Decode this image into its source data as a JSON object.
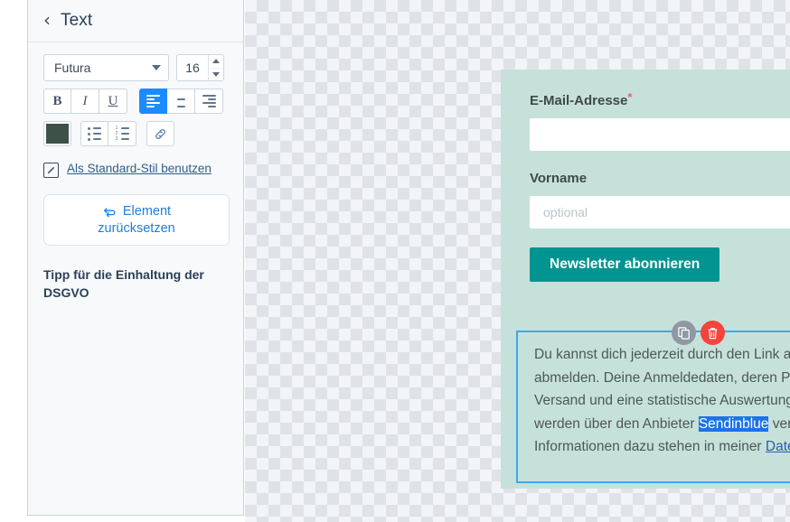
{
  "sidebar": {
    "back_icon": "chevron-left-icon",
    "title": "Text",
    "font": {
      "value": "Futura",
      "dropdown_icon": "chevron-down-icon"
    },
    "font_size": {
      "value": "16",
      "up_icon": "triangle-up-icon",
      "down_icon": "triangle-down-icon"
    },
    "format_buttons": [
      {
        "name": "bold-button",
        "label": "B"
      },
      {
        "name": "italic-button",
        "label": "I"
      },
      {
        "name": "underline-button",
        "label": "U"
      }
    ],
    "align_buttons": [
      {
        "name": "align-left-button",
        "label": "",
        "active": true
      },
      {
        "name": "align-center-button",
        "label": "",
        "active": false
      },
      {
        "name": "align-right-button",
        "label": "",
        "active": false
      }
    ],
    "color_swatch": "#3d5148",
    "list_buttons": [
      {
        "name": "bulleted-list-button"
      },
      {
        "name": "numbered-list-button"
      }
    ],
    "link_button": {
      "name": "link-button",
      "icon": "link-icon"
    },
    "default_style": {
      "icon": "edit-pencil-icon",
      "label": "Als Standard-Stil benutzen"
    },
    "reset_button": {
      "icon": "reset-arrows-icon",
      "line1": "Element",
      "line2": "zurücksetzen"
    },
    "tip_heading": "Tipp für die Einhaltung der DSGVO"
  },
  "canvas": {
    "form": {
      "email": {
        "label": "E-Mail-Adresse",
        "required_marker": "*",
        "value": "",
        "placeholder": ""
      },
      "firstname": {
        "label": "Vorname",
        "value": "",
        "placeholder": "optional"
      },
      "submit_label": "Newsletter abonnieren",
      "submit_color": "#029490"
    },
    "text_block": {
      "part1": "Du kannst dich jederzeit durch den Link am Ende jedes Newsletters abmelden. Deine Anmeldedaten, deren Protokollierung, der E-Mail-Versand und eine statistische Auswertung des Leseverhaltens werden über den Anbieter ",
      "selected": "Sendinblue",
      "part2": " verarbeitet. Alle Informationen dazu stehen in meiner ",
      "link": "Datenschutzerklärung",
      "part3": ".",
      "selection_color": "#1a73e8",
      "border_color": "#3ba7ef"
    },
    "actions": {
      "duplicate": {
        "icon": "copy-icon",
        "color": "#8f97a3"
      },
      "delete": {
        "icon": "trash-icon",
        "color": "#f2453d"
      }
    },
    "card_background": "#c6e1d9"
  }
}
